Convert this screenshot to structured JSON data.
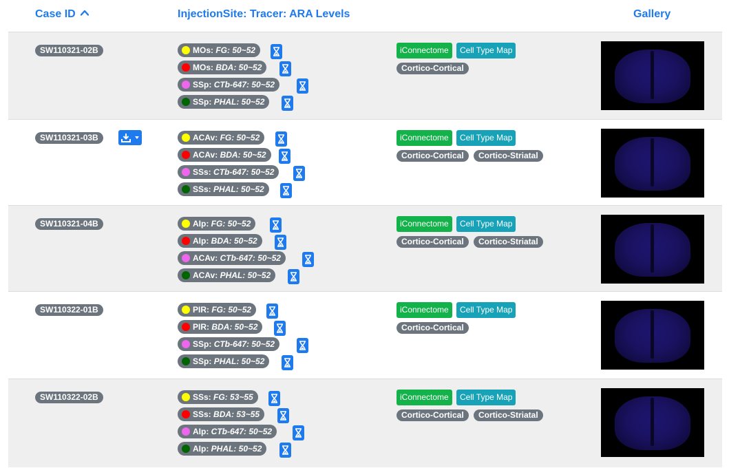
{
  "header": {
    "case_id": "Case ID",
    "injection": "InjectionSite: Tracer: ARA Levels",
    "gallery": "Gallery"
  },
  "icons": {
    "sort": "chevron-up-icon",
    "download": "download-icon",
    "hourglass": "hourglass-icon"
  },
  "colors": {
    "link": "#1f7aed",
    "badge_gray": "#6c757d",
    "iconnectome_green": "#14b24a",
    "celltype_teal": "#17a2b8",
    "row_shade": "#efefef",
    "tracer_fg": "#ffff00",
    "tracer_bda": "#ff0000",
    "tracer_ctb647": "#ee66ee",
    "tracer_phal": "#006400"
  },
  "rows": [
    {
      "case_id": "SW110321-02B",
      "has_download": false,
      "injections": [
        {
          "site": "MOs:",
          "tracer": "FG: 50~52",
          "dot": "yellow"
        },
        {
          "site": "MOs:",
          "tracer": "BDA: 50~52",
          "dot": "red"
        },
        {
          "site": "SSp:",
          "tracer": "CTb-647: 50~52",
          "dot": "pink"
        },
        {
          "site": "SSp:",
          "tracer": "PHAL: 50~52",
          "dot": "green"
        }
      ],
      "iconnectome": "iConnectome",
      "cell_type_map": "Cell Type Map",
      "tags": [
        "Cortico-Cortical"
      ]
    },
    {
      "case_id": "SW110321-03B",
      "has_download": true,
      "injections": [
        {
          "site": "ACAv:",
          "tracer": "FG: 50~52",
          "dot": "yellow"
        },
        {
          "site": "ACAv:",
          "tracer": "BDA: 50~52",
          "dot": "red"
        },
        {
          "site": "SSs:",
          "tracer": "CTb-647: 50~52",
          "dot": "pink"
        },
        {
          "site": "SSs:",
          "tracer": "PHAL: 50~52",
          "dot": "green"
        }
      ],
      "iconnectome": "iConnectome",
      "cell_type_map": "Cell Type Map",
      "tags": [
        "Cortico-Cortical",
        "Cortico-Striatal"
      ]
    },
    {
      "case_id": "SW110321-04B",
      "has_download": false,
      "injections": [
        {
          "site": "AIp:",
          "tracer": "FG: 50~52",
          "dot": "yellow"
        },
        {
          "site": "AIp:",
          "tracer": "BDA: 50~52",
          "dot": "red"
        },
        {
          "site": "ACAv:",
          "tracer": "CTb-647: 50~52",
          "dot": "pink"
        },
        {
          "site": "ACAv:",
          "tracer": "PHAL: 50~52",
          "dot": "green"
        }
      ],
      "iconnectome": "iConnectome",
      "cell_type_map": "Cell Type Map",
      "tags": [
        "Cortico-Cortical",
        "Cortico-Striatal"
      ]
    },
    {
      "case_id": "SW110322-01B",
      "has_download": false,
      "injections": [
        {
          "site": "PIR:",
          "tracer": "FG: 50~52",
          "dot": "yellow"
        },
        {
          "site": "PIR:",
          "tracer": "BDA: 50~52",
          "dot": "red"
        },
        {
          "site": "SSp:",
          "tracer": "CTb-647: 50~52",
          "dot": "pink"
        },
        {
          "site": "SSp:",
          "tracer": "PHAL: 50~52",
          "dot": "green"
        }
      ],
      "iconnectome": "iConnectome",
      "cell_type_map": "Cell Type Map",
      "tags": [
        "Cortico-Cortical"
      ]
    },
    {
      "case_id": "SW110322-02B",
      "has_download": false,
      "injections": [
        {
          "site": "SSs:",
          "tracer": "FG: 53~55",
          "dot": "yellow"
        },
        {
          "site": "SSs:",
          "tracer": "BDA: 53~55",
          "dot": "red"
        },
        {
          "site": "AIp:",
          "tracer": "CTb-647: 50~52",
          "dot": "pink"
        },
        {
          "site": "AIp:",
          "tracer": "PHAL: 50~52",
          "dot": "green"
        }
      ],
      "iconnectome": "iConnectome",
      "cell_type_map": "Cell Type Map",
      "tags": [
        "Cortico-Cortical",
        "Cortico-Striatal"
      ]
    }
  ]
}
